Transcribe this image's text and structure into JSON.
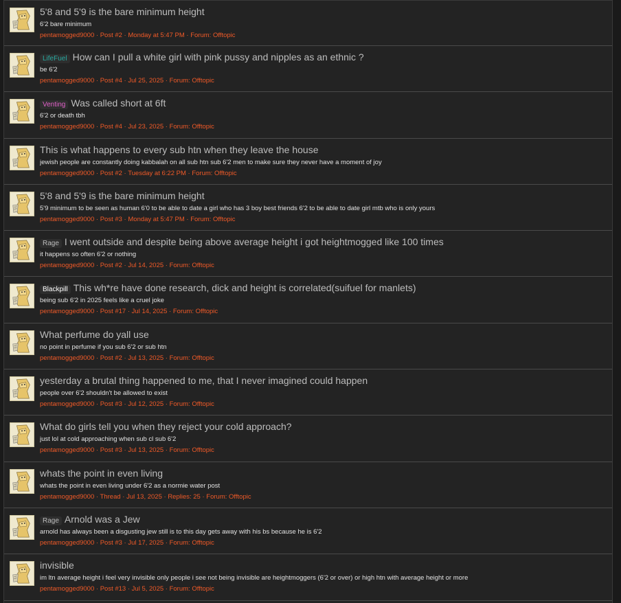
{
  "avatar_icon": "cartoon-character-icon",
  "colors": {
    "meta": "#f05a28",
    "title": "#bdbdbd",
    "lifefuel": "#27a9a0",
    "venting": "#e060c8",
    "rage": "#bdbdbd",
    "blackpill": "#ffffff"
  },
  "results": [
    {
      "prefix": "",
      "prefix_color": "",
      "title": "5'8 and 5'9 is the bare minimum height",
      "snippet": "6'2 bare minimum",
      "author": "pentamogged9000",
      "kind": "Post #2",
      "date": "Monday at 5:47 PM",
      "replies": "",
      "forum": "Forum: Offtopic"
    },
    {
      "prefix": "LifeFuel",
      "prefix_color": "#27a9a0",
      "title": "How can I pull a white girl with pink pussy and nipples as an ethnic ?",
      "snippet": "be 6'2",
      "author": "pentamogged9000",
      "kind": "Post #4",
      "date": "Jul 25, 2025",
      "replies": "",
      "forum": "Forum: Offtopic"
    },
    {
      "prefix": "Venting",
      "prefix_color": "#e060c8",
      "title": "Was called short at 6ft",
      "snippet": "6'2 or death tbh",
      "author": "pentamogged9000",
      "kind": "Post #4",
      "date": "Jul 23, 2025",
      "replies": "",
      "forum": "Forum: Offtopic"
    },
    {
      "prefix": "",
      "prefix_color": "",
      "title": "This is what happens to every sub htn when they leave the house",
      "snippet": "jewish people are constantly doing kabbalah on all sub htn sub 6'2 men to make sure they never have a moment of joy",
      "author": "pentamogged9000",
      "kind": "Post #2",
      "date": "Tuesday at 6:22 PM",
      "replies": "",
      "forum": "Forum: Offtopic"
    },
    {
      "prefix": "",
      "prefix_color": "",
      "title": "5'8 and 5'9 is the bare minimum height",
      "snippet": "5'9 minimum to be seen as human 6'0 to be able to date a girl who has 3 boy best friends 6'2 to be able to date girl mtb who is only yours",
      "author": "pentamogged9000",
      "kind": "Post #3",
      "date": "Monday at 5:47 PM",
      "replies": "",
      "forum": "Forum: Offtopic"
    },
    {
      "prefix": "Rage",
      "prefix_color": "#bdbdbd",
      "title": "I went outside and despite being above average height i got heightmogged like 100 times",
      "snippet": "it happens so often 6'2 or nothing",
      "author": "pentamogged9000",
      "kind": "Post #2",
      "date": "Jul 14, 2025",
      "replies": "",
      "forum": "Forum: Offtopic"
    },
    {
      "prefix": "Blackpill",
      "prefix_color": "#ffffff",
      "title": "This wh*re have done research, dick and height is correlated(suifuel for manlets)",
      "snippet": "being sub 6'2 in 2025 feels like a cruel joke",
      "author": "pentamogged9000",
      "kind": "Post #17",
      "date": "Jul 14, 2025",
      "replies": "",
      "forum": "Forum: Offtopic"
    },
    {
      "prefix": "",
      "prefix_color": "",
      "title": "What perfume do yall use",
      "snippet": "no point in perfume if you sub 6'2 or sub htn",
      "author": "pentamogged9000",
      "kind": "Post #2",
      "date": "Jul 13, 2025",
      "replies": "",
      "forum": "Forum: Offtopic"
    },
    {
      "prefix": "",
      "prefix_color": "",
      "title": "yesterday a brutal thing happened to me, that I never imagined could happen",
      "snippet": "people over 6'2 shouldn't be allowed to exist",
      "author": "pentamogged9000",
      "kind": "Post #3",
      "date": "Jul 12, 2025",
      "replies": "",
      "forum": "Forum: Offtopic"
    },
    {
      "prefix": "",
      "prefix_color": "",
      "title": "What do girls tell you when they reject your cold approach?",
      "snippet": "just lol at cold approaching when sub cl sub 6'2",
      "author": "pentamogged9000",
      "kind": "Post #3",
      "date": "Jul 13, 2025",
      "replies": "",
      "forum": "Forum: Offtopic"
    },
    {
      "prefix": "",
      "prefix_color": "",
      "title": "whats the point in even living",
      "snippet": "whats the point in even living under 6'2 as a normie water post",
      "author": "pentamogged9000",
      "kind": "Thread",
      "date": "Jul 13, 2025",
      "replies": "Replies: 25",
      "forum": "Forum: Offtopic"
    },
    {
      "prefix": "Rage",
      "prefix_color": "#bdbdbd",
      "title": "Arnold was a Jew",
      "snippet": "arnold has always been a disgusting jew still is to this day gets away with his bs because he is 6'2",
      "author": "pentamogged9000",
      "kind": "Post #3",
      "date": "Jul 17, 2025",
      "replies": "",
      "forum": "Forum: Offtopic"
    },
    {
      "prefix": "",
      "prefix_color": "",
      "title": "invisible",
      "snippet": "im ltn average height i feel very invisible only people i see not being invisible are heightmoggers (6'2 or over) or high htn with average height or more",
      "author": "pentamogged9000",
      "kind": "Post #13",
      "date": "Jul 5, 2025",
      "replies": "",
      "forum": "Forum: Offtopic"
    }
  ]
}
